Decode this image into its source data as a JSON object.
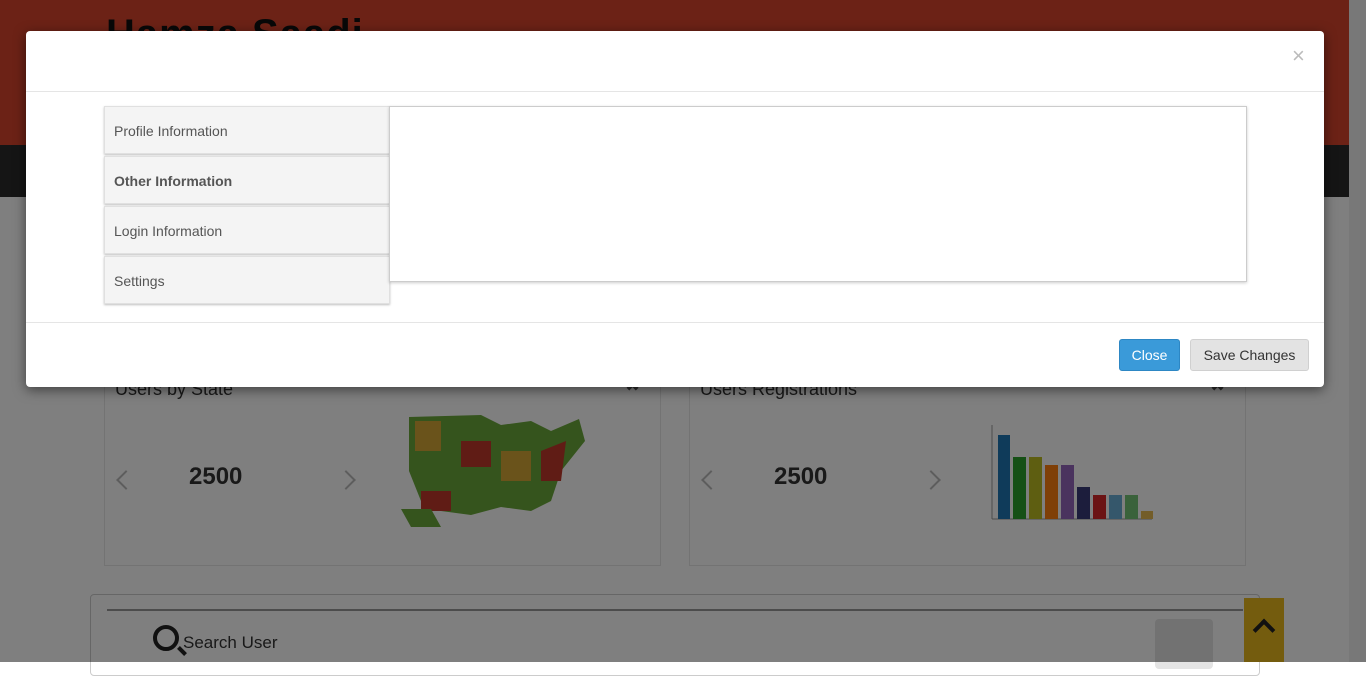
{
  "background": {
    "site_title": "Hamza Saadi",
    "panels": [
      {
        "title": "Users by State",
        "count": "2500"
      },
      {
        "title": "Users Registrations",
        "count": "2500"
      }
    ],
    "search": {
      "label": "Search User"
    },
    "colors": {
      "header": "#d9442c",
      "nav": "#2a2a2a",
      "scroll_top": "#e8b81c"
    }
  },
  "modal": {
    "close_symbol": "×",
    "tabs": [
      {
        "label": "Profile Information",
        "active": false
      },
      {
        "label": "Other Information",
        "active": true
      },
      {
        "label": "Login Information",
        "active": false
      },
      {
        "label": "Settings",
        "active": false
      }
    ],
    "footer": {
      "close_label": "Close",
      "save_label": "Save Changes"
    },
    "colors": {
      "close_button": "#3a9ad9",
      "tab_accent": "#2e6aa8"
    }
  }
}
